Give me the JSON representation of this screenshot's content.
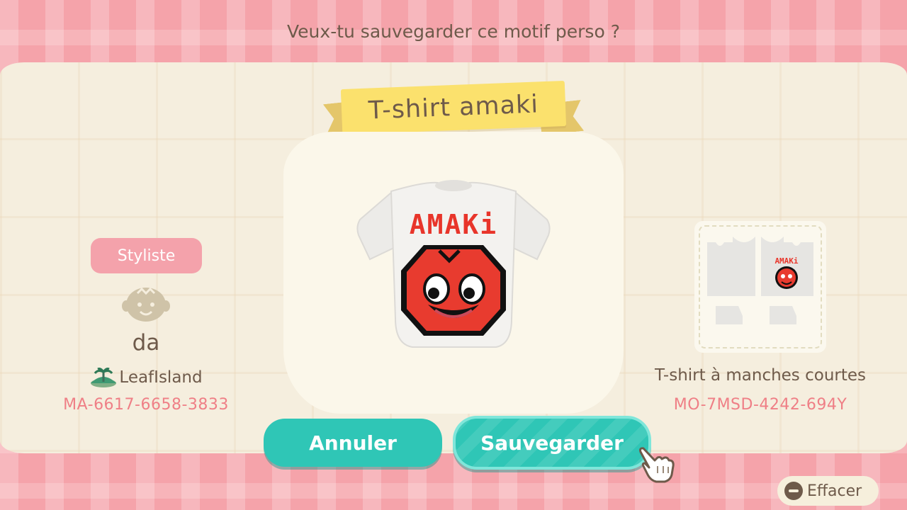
{
  "dialog": {
    "prompt": "Veux-tu sauvegarder ce motif perso ?",
    "design_name": "T-shirt amaki"
  },
  "designer": {
    "badge_label": "Styliste",
    "player_name": "da",
    "island_name": "LeafIsland",
    "creator_code": "MA-6617-6658-3833"
  },
  "design": {
    "garment_type": "T-shirt à manches courtes",
    "design_code": "MO-7MSD-4242-694Y",
    "shirt_text": "AMAKi"
  },
  "buttons": {
    "cancel_label": "Annuler",
    "save_label": "Sauvegarder"
  },
  "hint": {
    "clear_label": "Effacer",
    "clear_icon": "minus-button-icon"
  },
  "colors": {
    "accent_teal": "#2fc6b6",
    "banner_yellow": "#fbe16d",
    "badge_pink": "#f4a2ab",
    "code_pink": "#ef7f86",
    "text_brown": "#6e5a4a",
    "shirt_red": "#e83b2f"
  }
}
